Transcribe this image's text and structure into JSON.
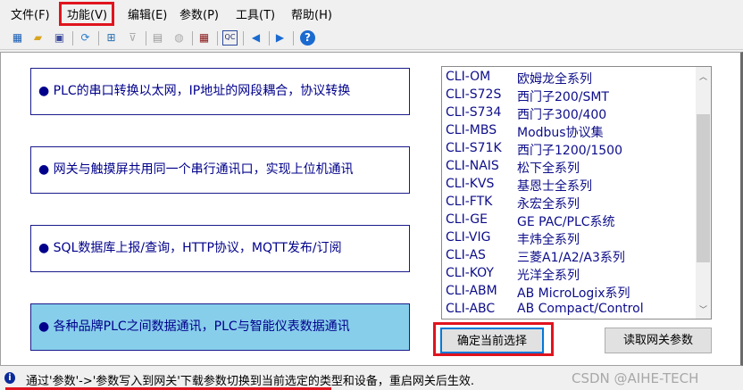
{
  "menu": [
    "文件(F)",
    "功能(V)",
    "编辑(E)",
    "参数(P)",
    "工具(T)",
    "帮助(H)"
  ],
  "toolbar": [
    "network-icon",
    "open-folder-icon",
    "save-icon",
    "refresh-icon",
    "topology-icon",
    "plug-icon",
    "monitor-icon",
    "gauge-icon",
    "table-icon",
    "qc-icon",
    "arrow-left-icon",
    "arrow-right-icon",
    "help-icon"
  ],
  "features": [
    "● PLC的串口转换以太网，IP地址的网段耦合，协议转换",
    "● 网关与触摸屏共用同一个串行通讯口，实现上位机通讯",
    "● SQL数据库上报/查询，HTTP协议，MQTT发布/订阅",
    "● 各种品牌PLC之间数据通讯，PLC与智能仪表数据通讯"
  ],
  "devices": [
    {
      "code": "CLI-OM",
      "desc": "欧姆龙全系列"
    },
    {
      "code": "CLI-S72S",
      "desc": "西门子200/SMT"
    },
    {
      "code": "CLI-S734",
      "desc": "西门子300/400"
    },
    {
      "code": "CLI-MBS",
      "desc": "Modbus协议集"
    },
    {
      "code": "CLI-S71K",
      "desc": "西门子1200/1500"
    },
    {
      "code": "CLI-NAIS",
      "desc": "松下全系列"
    },
    {
      "code": "CLI-KVS",
      "desc": "基恩士全系列"
    },
    {
      "code": "CLI-FTK",
      "desc": "永宏全系列"
    },
    {
      "code": "CLI-GE",
      "desc": "GE PAC/PLC系统"
    },
    {
      "code": "CLI-VIG",
      "desc": "丰炜全系列"
    },
    {
      "code": "CLI-AS",
      "desc": "三菱A1/A2/A3系列"
    },
    {
      "code": "CLI-KOY",
      "desc": "光洋全系列"
    },
    {
      "code": "CLI-ABM",
      "desc": "AB MicroLogix系列"
    },
    {
      "code": "CLI-ABC",
      "desc": "AB Compact/Control"
    }
  ],
  "buttons": {
    "confirm": "确定当前选择",
    "read": "读取网关参数"
  },
  "status": {
    "text": "通过'参数'->'参数写入到网关'下载参数切换到当前选定的类型和设备，重启网关后生效.",
    "watermark": "CSDN @AIHE-TECH"
  }
}
